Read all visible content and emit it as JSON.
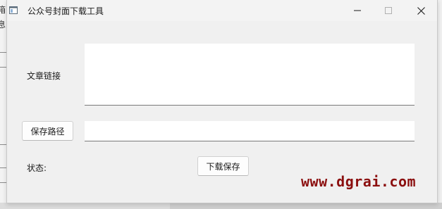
{
  "background": {
    "chars": [
      "箱",
      "息"
    ]
  },
  "window": {
    "title": "公众号封面下载工具",
    "controls": {
      "minimize_icon": "minimize-icon",
      "maximize_icon": "maximize-icon",
      "close_icon": "close-icon"
    }
  },
  "form": {
    "article_link_label": "文章链接",
    "article_link_value": "",
    "save_path_button": "保存路径",
    "save_path_value": "",
    "status_label": "状态:",
    "download_button": "下载保存"
  },
  "watermark": {
    "text": "www.dgrai.com",
    "color": "#8b0f0f"
  }
}
